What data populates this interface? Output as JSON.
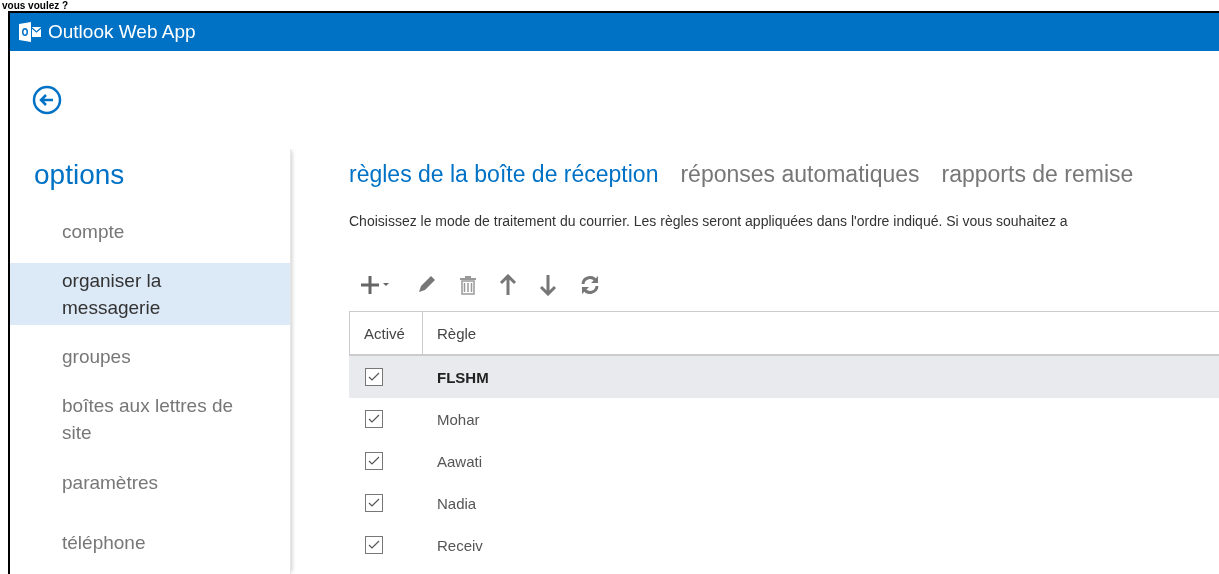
{
  "caption": "vous voulez ?",
  "window": {
    "title": "Outlook Web App"
  },
  "sidebar": {
    "heading": "options",
    "items": [
      {
        "label": "compte",
        "selected": false
      },
      {
        "label": "organiser la messagerie",
        "selected": true
      },
      {
        "label": "groupes",
        "selected": false
      },
      {
        "label": "boîtes aux lettres de site",
        "selected": false
      },
      {
        "label": "paramètres",
        "selected": false
      },
      {
        "label": "téléphone",
        "selected": false
      }
    ]
  },
  "tabs": [
    {
      "label": "règles de la boîte de réception",
      "selected": true
    },
    {
      "label": "réponses automatiques",
      "selected": false
    },
    {
      "label": "rapports de remise",
      "selected": false
    }
  ],
  "description": "Choisissez le mode de traitement du courrier. Les règles seront appliquées dans l'ordre indiqué. Si vous souhaitez a",
  "toolbar": [
    {
      "kind": "add"
    },
    {
      "kind": "edit"
    },
    {
      "kind": "delete"
    },
    {
      "kind": "up"
    },
    {
      "kind": "down"
    },
    {
      "kind": "refresh"
    }
  ],
  "table": {
    "columns": [
      "Activé",
      "Règle"
    ],
    "rows": [
      {
        "checked": true,
        "name": "FLSHM",
        "selected": true
      },
      {
        "checked": true,
        "name": "Mohar",
        "selected": false
      },
      {
        "checked": true,
        "name": "Aawati",
        "selected": false
      },
      {
        "checked": true,
        "name": "Nadia",
        "selected": false
      },
      {
        "checked": true,
        "name": "Receiv",
        "selected": false
      }
    ]
  }
}
